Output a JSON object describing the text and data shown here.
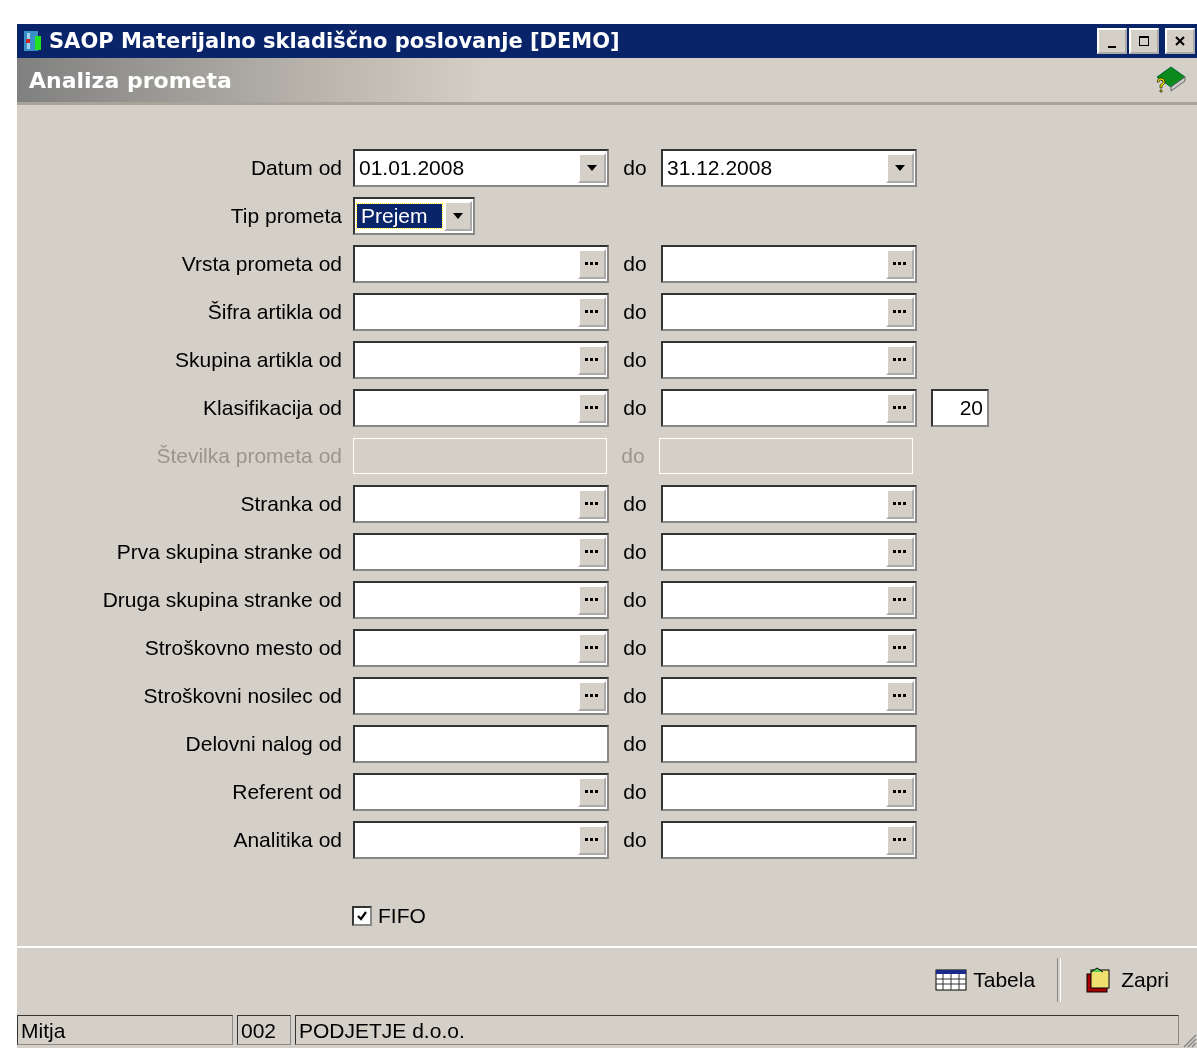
{
  "window": {
    "title": "SAOP Materijalno skladiščno poslovanje [DEMO]"
  },
  "header": {
    "title": "Analiza prometa"
  },
  "rows": [
    {
      "label": "Datum od",
      "kind": "date",
      "disabled": false,
      "from": "01.01.2008",
      "separator": "do",
      "to": "31.12.2008"
    },
    {
      "label": "Tip prometa",
      "kind": "combo",
      "disabled": false,
      "value": "Prejem"
    },
    {
      "label": "Vrsta prometa od",
      "kind": "picker",
      "disabled": false,
      "separator": "do"
    },
    {
      "label": "Šifra artikla od",
      "kind": "picker",
      "disabled": false,
      "separator": "do"
    },
    {
      "label": "Skupina artikla od",
      "kind": "picker",
      "disabled": false,
      "separator": "do"
    },
    {
      "label": "Klasifikacija od",
      "kind": "picker",
      "disabled": false,
      "separator": "do",
      "extra": "20"
    },
    {
      "label": "Številka prometa od",
      "kind": "plain",
      "disabled": true,
      "separator": "do"
    },
    {
      "label": "Stranka od",
      "kind": "picker",
      "disabled": false,
      "separator": "do"
    },
    {
      "label": "Prva skupina stranke od",
      "kind": "picker",
      "disabled": false,
      "separator": "do"
    },
    {
      "label": "Druga skupina stranke od",
      "kind": "picker",
      "disabled": false,
      "separator": "do"
    },
    {
      "label": "Stroškovno mesto od",
      "kind": "picker",
      "disabled": false,
      "separator": "do"
    },
    {
      "label": "Stroškovni nosilec od",
      "kind": "picker",
      "disabled": false,
      "separator": "do"
    },
    {
      "label": "Delovni nalog od",
      "kind": "plain",
      "disabled": false,
      "separator": "do"
    },
    {
      "label": "Referent od",
      "kind": "picker",
      "disabled": false,
      "separator": "do"
    },
    {
      "label": "Analitika od",
      "kind": "picker",
      "disabled": false,
      "separator": "do"
    }
  ],
  "fifo": {
    "label": "FIFO",
    "checked": true
  },
  "buttons": [
    {
      "label": "Tabela",
      "kind": "table"
    },
    {
      "label": "Zapri",
      "kind": "close"
    }
  ],
  "status_bar": [
    "Mitja",
    "002",
    "PODJETJE d.o.o."
  ]
}
